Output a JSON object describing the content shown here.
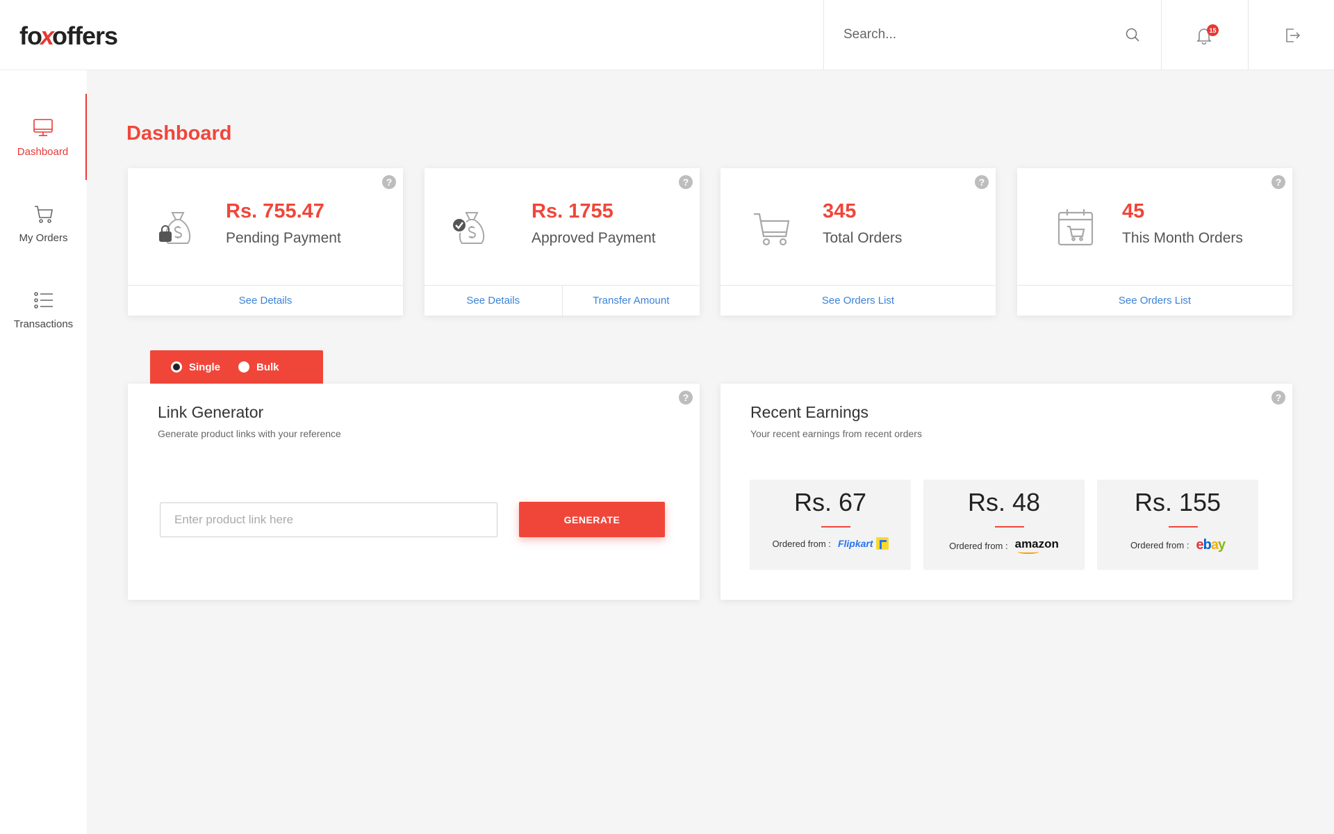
{
  "brand": {
    "logo_pre": "fo",
    "logo_x": "x",
    "logo_post": "offers"
  },
  "header": {
    "search_placeholder": "Search...",
    "notification_count": "15"
  },
  "sidebar": {
    "items": [
      {
        "label": "Dashboard",
        "icon": "monitor-icon",
        "active": true
      },
      {
        "label": "My Orders",
        "icon": "cart-icon",
        "active": false
      },
      {
        "label": "Transactions",
        "icon": "list-icon",
        "active": false
      }
    ]
  },
  "page": {
    "title": "Dashboard"
  },
  "stats": [
    {
      "value": "Rs. 755.47",
      "label": "Pending Payment",
      "icon": "money-bag-lock-icon",
      "links": [
        "See Details"
      ]
    },
    {
      "value": "Rs. 1755",
      "label": "Approved Payment",
      "icon": "money-bag-check-icon",
      "links": [
        "See Details",
        "Transfer Amount"
      ]
    },
    {
      "value": "345",
      "label": "Total Orders",
      "icon": "cart-icon",
      "links": [
        "See Orders List"
      ]
    },
    {
      "value": "45",
      "label": "This Month Orders",
      "icon": "calendar-cart-icon",
      "links": [
        "See Orders List"
      ]
    }
  ],
  "help_label": "?",
  "link_generator": {
    "modes": [
      {
        "label": "Single",
        "checked": true
      },
      {
        "label": "Bulk",
        "checked": false
      }
    ],
    "title": "Link Generator",
    "subtitle": "Generate product links with your reference",
    "input_placeholder": "Enter product link here",
    "input_value": "",
    "button_label": "GENERATE"
  },
  "recent_earnings": {
    "title": "Recent Earnings",
    "subtitle": "Your recent earnings from recent orders",
    "ordered_from_label": "Ordered from :",
    "items": [
      {
        "amount": "Rs. 67",
        "store": "Flipkart"
      },
      {
        "amount": "Rs. 48",
        "store": "amazon"
      },
      {
        "amount": "Rs. 155",
        "store": "ebay"
      }
    ]
  },
  "colors": {
    "accent": "#f0463a",
    "link": "#3b82d6",
    "muted_icon": "#a8a8a8"
  }
}
